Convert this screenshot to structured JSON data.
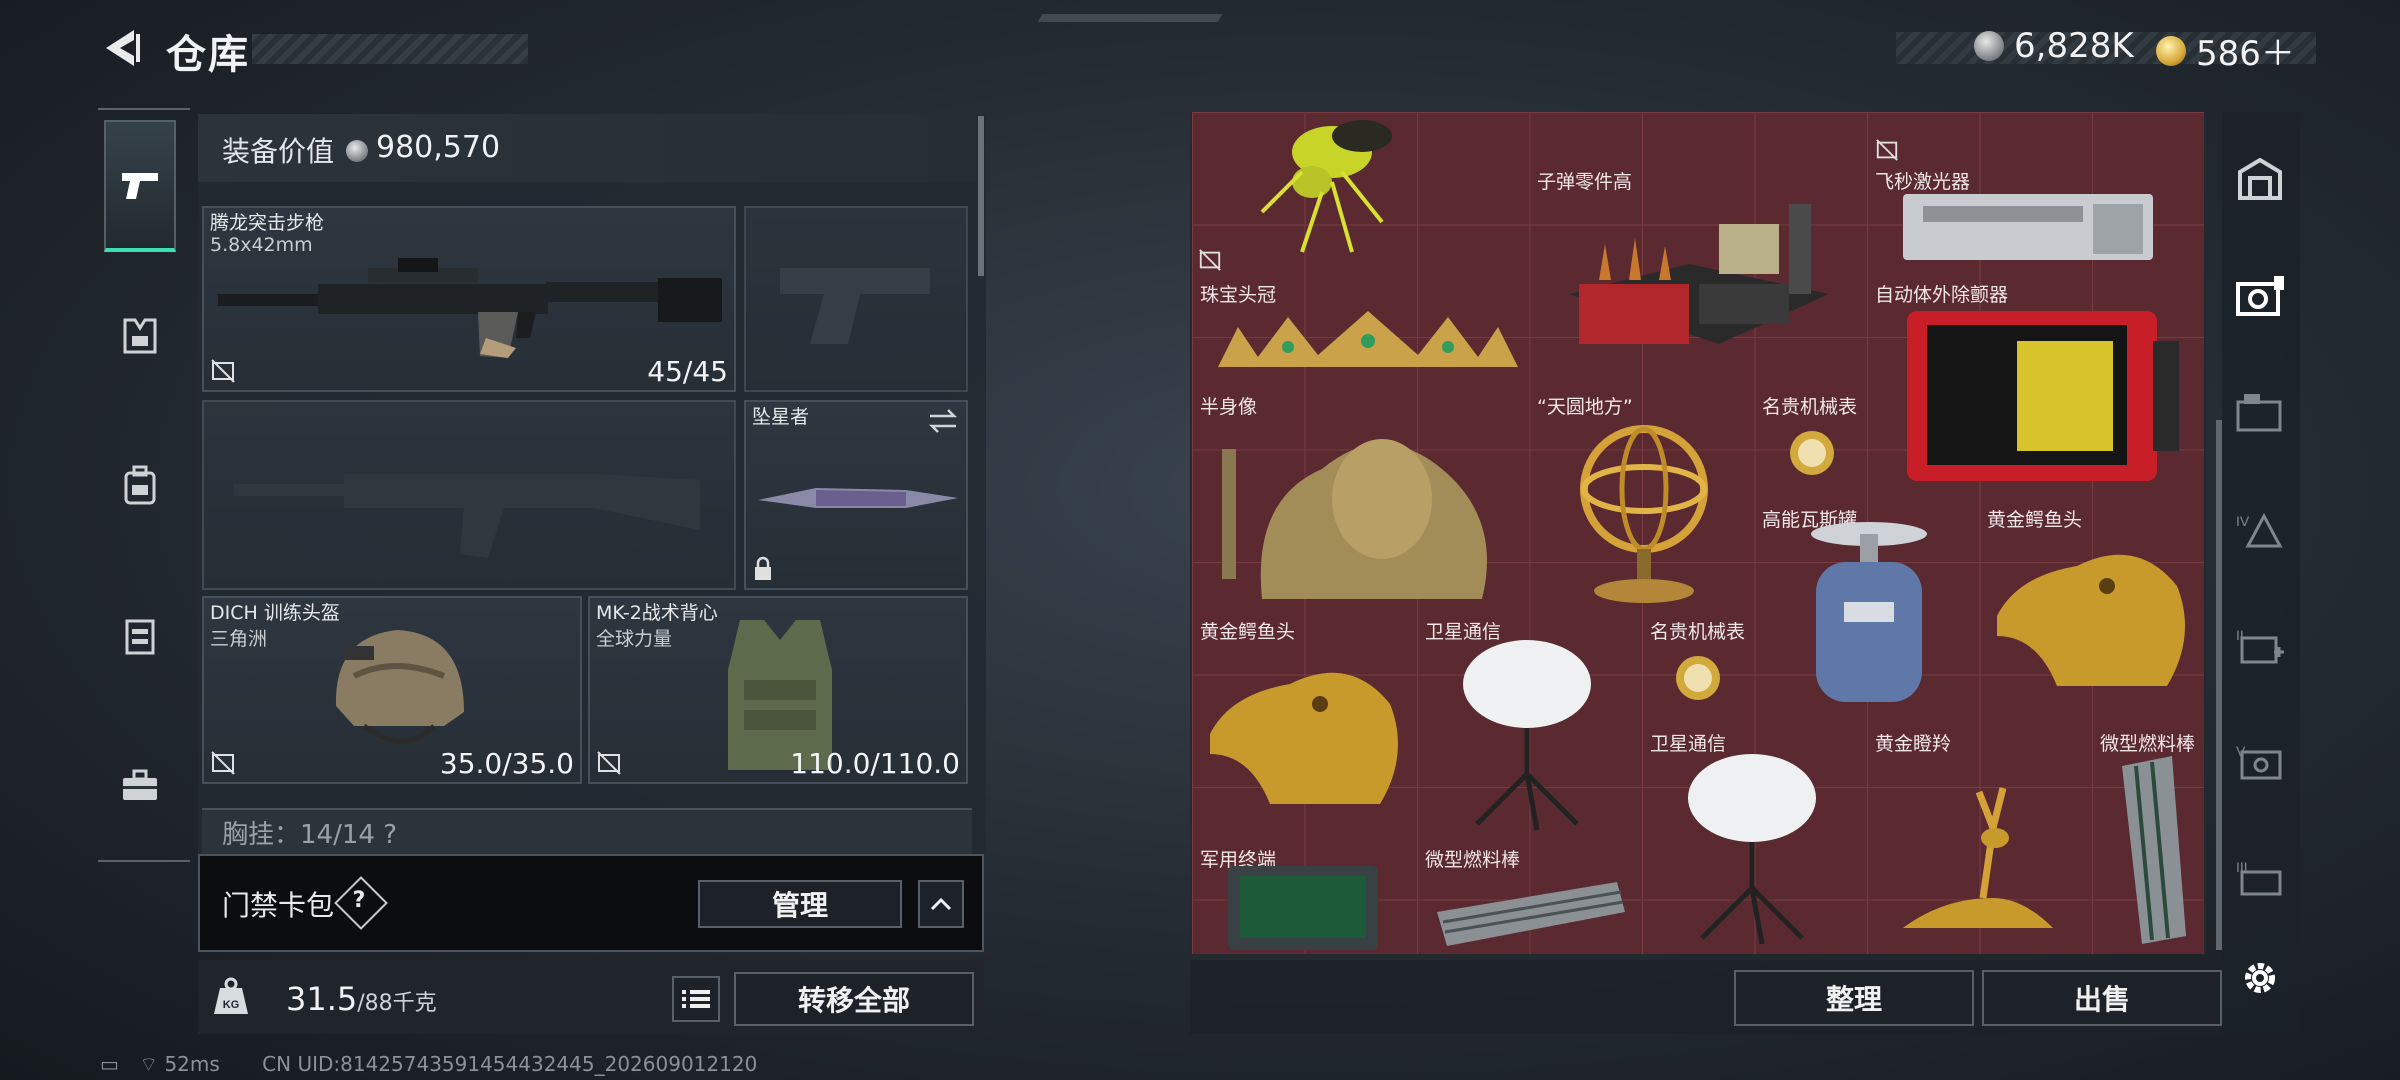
{
  "header": {
    "title": "仓库"
  },
  "currency": [
    {
      "icon": "silver-coin-icon",
      "value": "6,828K"
    },
    {
      "icon": "gold-coin-icon",
      "value": "586＋"
    }
  ],
  "left_nav": [
    {
      "icon": "pistol-icon",
      "active": true
    },
    {
      "icon": "armor-icon"
    },
    {
      "icon": "backpack-icon"
    },
    {
      "icon": "vest-icon"
    },
    {
      "icon": "briefcase-icon"
    }
  ],
  "equipment": {
    "value_label": "装备价值",
    "value": "980,570",
    "rifle": {
      "name": "腾龙突击步枪",
      "caliber": "5.8x42mm",
      "durability": "45/45"
    },
    "melee": {
      "name": "坠星者"
    },
    "helmet": {
      "name": "DICH 训练头盔",
      "sub": "三角洲",
      "durability": "35.0/35.0"
    },
    "vest": {
      "name": "MK-2战术背心",
      "sub": "全球力量",
      "durability": "110.0/110.0"
    },
    "chest_rig_partial": "胸挂：14/14  ?"
  },
  "door_card": {
    "label": "门禁卡包",
    "help": "?",
    "manage": "管理"
  },
  "weight": {
    "current": "31.5",
    "max": "/88千克",
    "transfer_all": "转移全部"
  },
  "status_bar": {
    "ping": "52ms",
    "uid": "CN UID:8142574359145443​2445_202609012120"
  },
  "stash": {
    "items": [
      {
        "name": "",
        "key": "wasp"
      },
      {
        "name": "子弹零件高",
        "key": "ammo-parts"
      },
      {
        "name": "飞秒激光器",
        "key": "laser"
      },
      {
        "name": "珠宝头冠",
        "key": "crown"
      },
      {
        "name": "自动体外除颤器",
        "key": "aed"
      },
      {
        "name": "半身像",
        "key": "bust"
      },
      {
        "name": "“天圆地方”",
        "key": "armillary"
      },
      {
        "name": "名贵机械表",
        "key": "watch1"
      },
      {
        "name": "高能瓦斯罐",
        "key": "gas"
      },
      {
        "name": "黄金鳄鱼头",
        "key": "croc1"
      },
      {
        "name": "黄金鳄鱼头",
        "key": "croc2"
      },
      {
        "name": "卫星通信",
        "key": "sat1"
      },
      {
        "name": "名贵机械表",
        "key": "watch2"
      },
      {
        "name": "卫星通信",
        "key": "sat2"
      },
      {
        "name": "黄金瞪羚",
        "key": "gazelle"
      },
      {
        "name": "微型燃料棒",
        "key": "fuel1"
      },
      {
        "name": "军用终端",
        "key": "terminal"
      },
      {
        "name": "微型燃料棒",
        "key": "fuel2"
      }
    ],
    "sort": "整理",
    "sell": "出售"
  },
  "right_nav": [
    "vault-icon",
    "stash-page-1-icon",
    "stash-page-2-icon",
    "stash-page-4-icon",
    "stash-page-2b-icon",
    "stash-page-5-icon",
    "stash-page-3-icon",
    "settings-icon"
  ],
  "colors": {
    "accent": "#3ce0b4",
    "grid_bg": "#5a2a30",
    "grid_line": "#7a3a42"
  }
}
